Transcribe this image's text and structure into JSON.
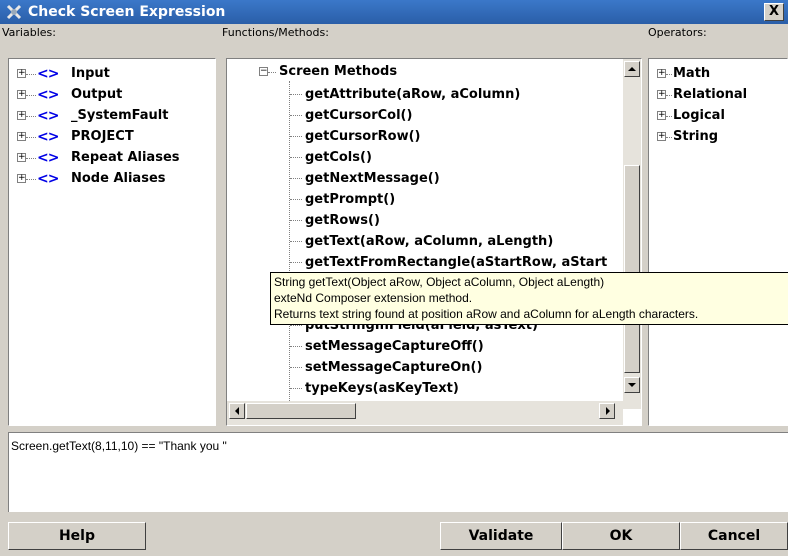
{
  "window": {
    "title": "Check Screen Expression",
    "close_label": "X"
  },
  "labels": {
    "variables": "Variables:",
    "functions": "Functions/Methods:",
    "operators": "Operators:"
  },
  "variables": [
    {
      "label": "Input"
    },
    {
      "label": "Output"
    },
    {
      "label": "_SystemFault"
    },
    {
      "label": "PROJECT"
    },
    {
      "label": "Repeat Aliases"
    },
    {
      "label": "Node Aliases"
    }
  ],
  "functions": {
    "group_label": "Screen Methods",
    "methods": [
      "getAttribute(aRow, aColumn)",
      "getCursorCol()",
      "getCursorRow()",
      "getCols()",
      "getNextMessage()",
      "getPrompt()",
      "getRows()",
      "getText(aRow, aColumn, aLength)",
      "getTextFromRectangle(aStartRow, aStart",
      "putStringInField(aField, asText)",
      "setMessageCaptureOff()",
      "setMessageCaptureOn()",
      "typeKeys(asKeyText)"
    ]
  },
  "operators": [
    {
      "label": "Math"
    },
    {
      "label": "Relational"
    },
    {
      "label": "Logical"
    },
    {
      "label": "String"
    }
  ],
  "tooltip": {
    "line1": "String getText(Object aRow, Object aColumn, Object aLength)",
    "line2": "exteNd Composer extension method.",
    "line3": "Returns text string found at position aRow and aColumn for aLength characters."
  },
  "expression": {
    "value": "Screen.getText(8,11,10) == \"Thank you \""
  },
  "buttons": {
    "help": "Help",
    "validate": "Validate",
    "ok": "OK",
    "cancel": "Cancel"
  },
  "colors": {
    "title_bar": "#2a5ea8",
    "tag_icon": "#0000e6",
    "tooltip_bg": "#ffffe1"
  }
}
